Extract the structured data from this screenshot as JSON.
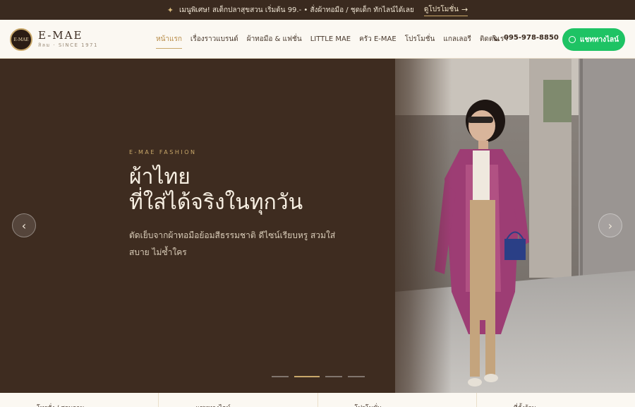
{
  "promo": {
    "icon": "sparkle-icon",
    "text": "เมนูพิเศษ! สเต็กปลาสุขสวน เริ่มต้น 99.- • สั่งผ้าทอมือ / ชุดเด็ก ทักไลน์ได้เลย",
    "link_label": "ดูโปรโมชั่น"
  },
  "brand": {
    "badge_text": "E-MAE",
    "name": "E-MAE",
    "tagline": "สิลม · SINCE 1971"
  },
  "nav": {
    "items": [
      "หน้าแรก",
      "เรื่องราวแบรนด์",
      "ผ้าทอมือ & แฟชั่น",
      "LITTLE MAE",
      "ครัว E-MAE",
      "โปรโมชั่น",
      "แกลเลอรี",
      "ติดต่อเรา"
    ],
    "active_index": 0
  },
  "header": {
    "phone": "095-978-8850",
    "cta_label": "แชททางไลน์"
  },
  "hero": {
    "eyebrow": "E-MAE FASHION",
    "title_line1": "ผ้าไทย",
    "title_line2": "ที่ใส่ได้จริงในทุกวัน",
    "subtitle": "ตัดเย็บจากผ้าทอมือย้อมสีธรรมชาติ ดีไซน์เรียบหรู สวมใส่สบาย ไม่ซ้ำใคร",
    "slide_count": 4,
    "active_slide": 2
  },
  "info_strip": {
    "columns": [
      "โทรสั่ง / สอบถาม",
      "แชททางไลน์",
      "โปรโมชั่น",
      "ที่ตั้งร้าน"
    ]
  },
  "colors": {
    "hero_bg": "#3e2c20",
    "accent_gold": "#c9a86a",
    "cta_green": "#1ec364",
    "promo_bg": "#3a2a1f"
  }
}
